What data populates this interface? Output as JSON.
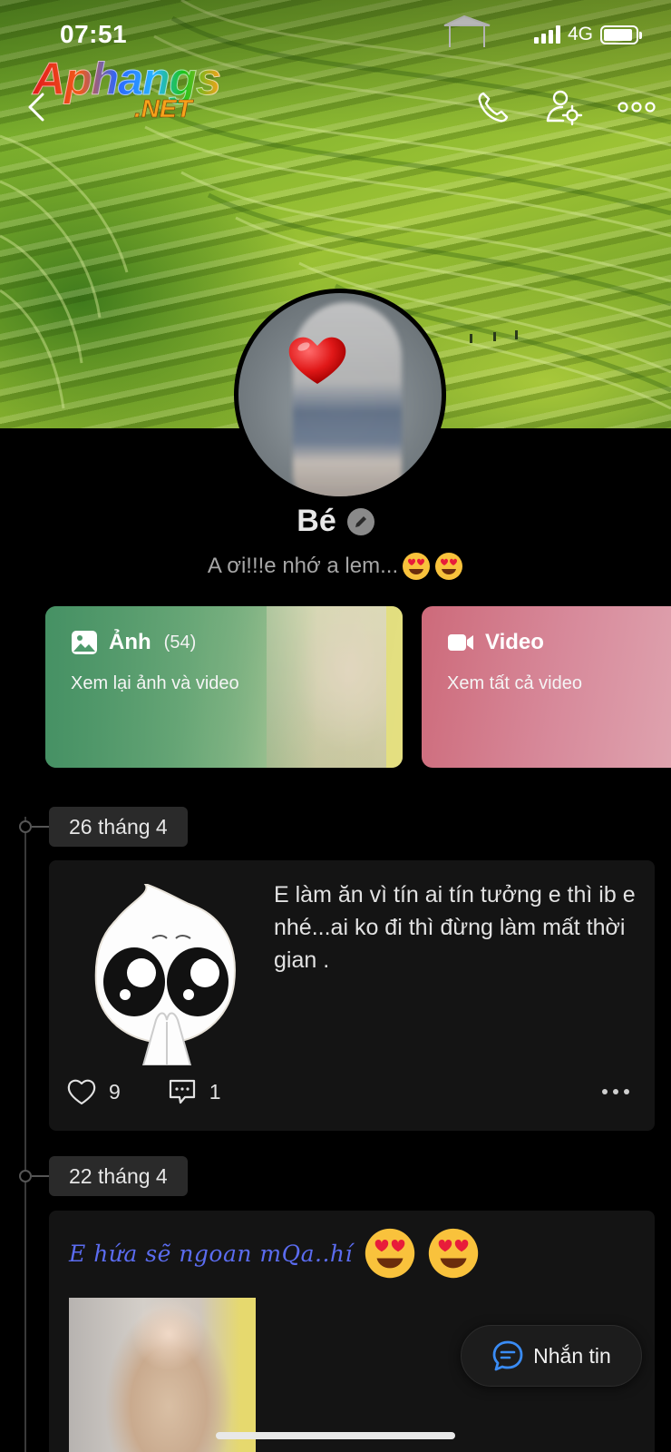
{
  "status_bar": {
    "time": "07:51",
    "network": "4G",
    "battery_level": 0.9
  },
  "watermark": {
    "main": "Aphangs",
    "sub": ".NET"
  },
  "header": {
    "back_icon": "chevron-left-icon",
    "call_icon": "phone-icon",
    "settings_icon": "user-settings-icon",
    "more_icon": "more-dots-icon"
  },
  "profile": {
    "name": "Bé",
    "bio": "A ơi!!!e nhớ a lem...",
    "bio_emojis": [
      "heart-eyes-emoji",
      "heart-eyes-emoji"
    ]
  },
  "media_cards": {
    "photos": {
      "title": "Ảnh",
      "count": "(54)",
      "subtitle": "Xem lại ảnh và video",
      "icon": "image-icon"
    },
    "videos": {
      "title": "Video",
      "subtitle": "Xem tất cả video",
      "icon": "video-camera-icon"
    }
  },
  "timeline": [
    {
      "date": "26 tháng 4",
      "text": "E làm ăn vì tín ai tín tưởng e thì ib e nhé...ai ko đi thì đừng làm mất thời gian .",
      "likes": "9",
      "comments": "1"
    },
    {
      "date": "22 tháng 4",
      "text": "E hứa sẽ ngoan mQa..hí"
    }
  ],
  "message_button": {
    "label": "Nhắn tin",
    "icon": "chat-bubble-icon"
  },
  "colors": {
    "background": "#000000",
    "card_bg": "#141414",
    "photos_card": "#3f8f63",
    "videos_card": "#cd6a7a",
    "fancy_text": "#5b6cf0"
  }
}
